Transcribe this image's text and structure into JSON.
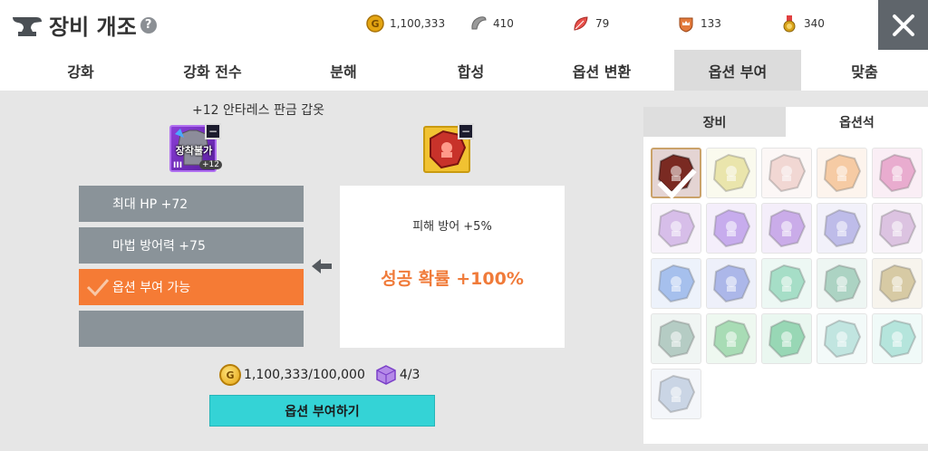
{
  "header": {
    "title": "장비 개조",
    "help_symbol": "?",
    "currencies": [
      {
        "name": "gold",
        "value": "1,100,333",
        "color": "#e4a512"
      },
      {
        "name": "silver-horn",
        "value": "410",
        "color": "#9a9a9a"
      },
      {
        "name": "red-leaf",
        "value": "79",
        "color": "#e8504a"
      },
      {
        "name": "crown-shield",
        "value": "133",
        "color": "#e37a3c"
      },
      {
        "name": "medal",
        "value": "340",
        "color": "#d8a31b"
      }
    ],
    "close_symbol": "✕"
  },
  "tabs": [
    {
      "label": "강화",
      "active": false
    },
    {
      "label": "강화 전수",
      "active": false
    },
    {
      "label": "분해",
      "active": false
    },
    {
      "label": "합성",
      "active": false
    },
    {
      "label": "옵션 변환",
      "active": false
    },
    {
      "label": "옵션 부여",
      "active": true
    },
    {
      "label": "맞춤",
      "active": false
    }
  ],
  "equipment": {
    "name": "+12 안타레스 판금 갑옷",
    "lock_label": "장착불가",
    "tier": "III",
    "plus": "+12",
    "corner": "−"
  },
  "stone": {
    "corner": "−"
  },
  "options": [
    {
      "label": "최대 HP   +72",
      "state": "normal"
    },
    {
      "label": "마법 방어력   +75",
      "state": "normal"
    },
    {
      "label": "옵션 부여 가능",
      "state": "active"
    },
    {
      "label": "",
      "state": "empty"
    }
  ],
  "result": {
    "option": "피해 방어   +5%",
    "success": "성공 확률 +100%"
  },
  "cost": {
    "gold_symbol": "G",
    "gold": "1,100,333/100,000",
    "cube": "4/3"
  },
  "apply_button": "옵션 부여하기",
  "right_panel": {
    "tabs": [
      {
        "label": "장비",
        "active": false
      },
      {
        "label": "옵션석",
        "active": true
      }
    ],
    "stones": [
      {
        "color": "#7a2a22",
        "selected": true
      },
      {
        "color": "#d9d16a"
      },
      {
        "color": "#e7b7b0"
      },
      {
        "color": "#f0a15a"
      },
      {
        "color": "#d86aa8"
      },
      {
        "color": "#b78ad8"
      },
      {
        "color": "#9a6ae0"
      },
      {
        "color": "#a06ad8"
      },
      {
        "color": "#8a86d8"
      },
      {
        "color": "#c093c9"
      },
      {
        "color": "#5e8ee0"
      },
      {
        "color": "#6a7ed8"
      },
      {
        "color": "#5fc49a"
      },
      {
        "color": "#6ab093"
      },
      {
        "color": "#b8a05a"
      },
      {
        "color": "#7aa394"
      },
      {
        "color": "#62c07a"
      },
      {
        "color": "#44b87a"
      },
      {
        "color": "#8fd0c8"
      },
      {
        "color": "#7ad0c0"
      },
      {
        "color": "#a0b4d0"
      }
    ]
  }
}
